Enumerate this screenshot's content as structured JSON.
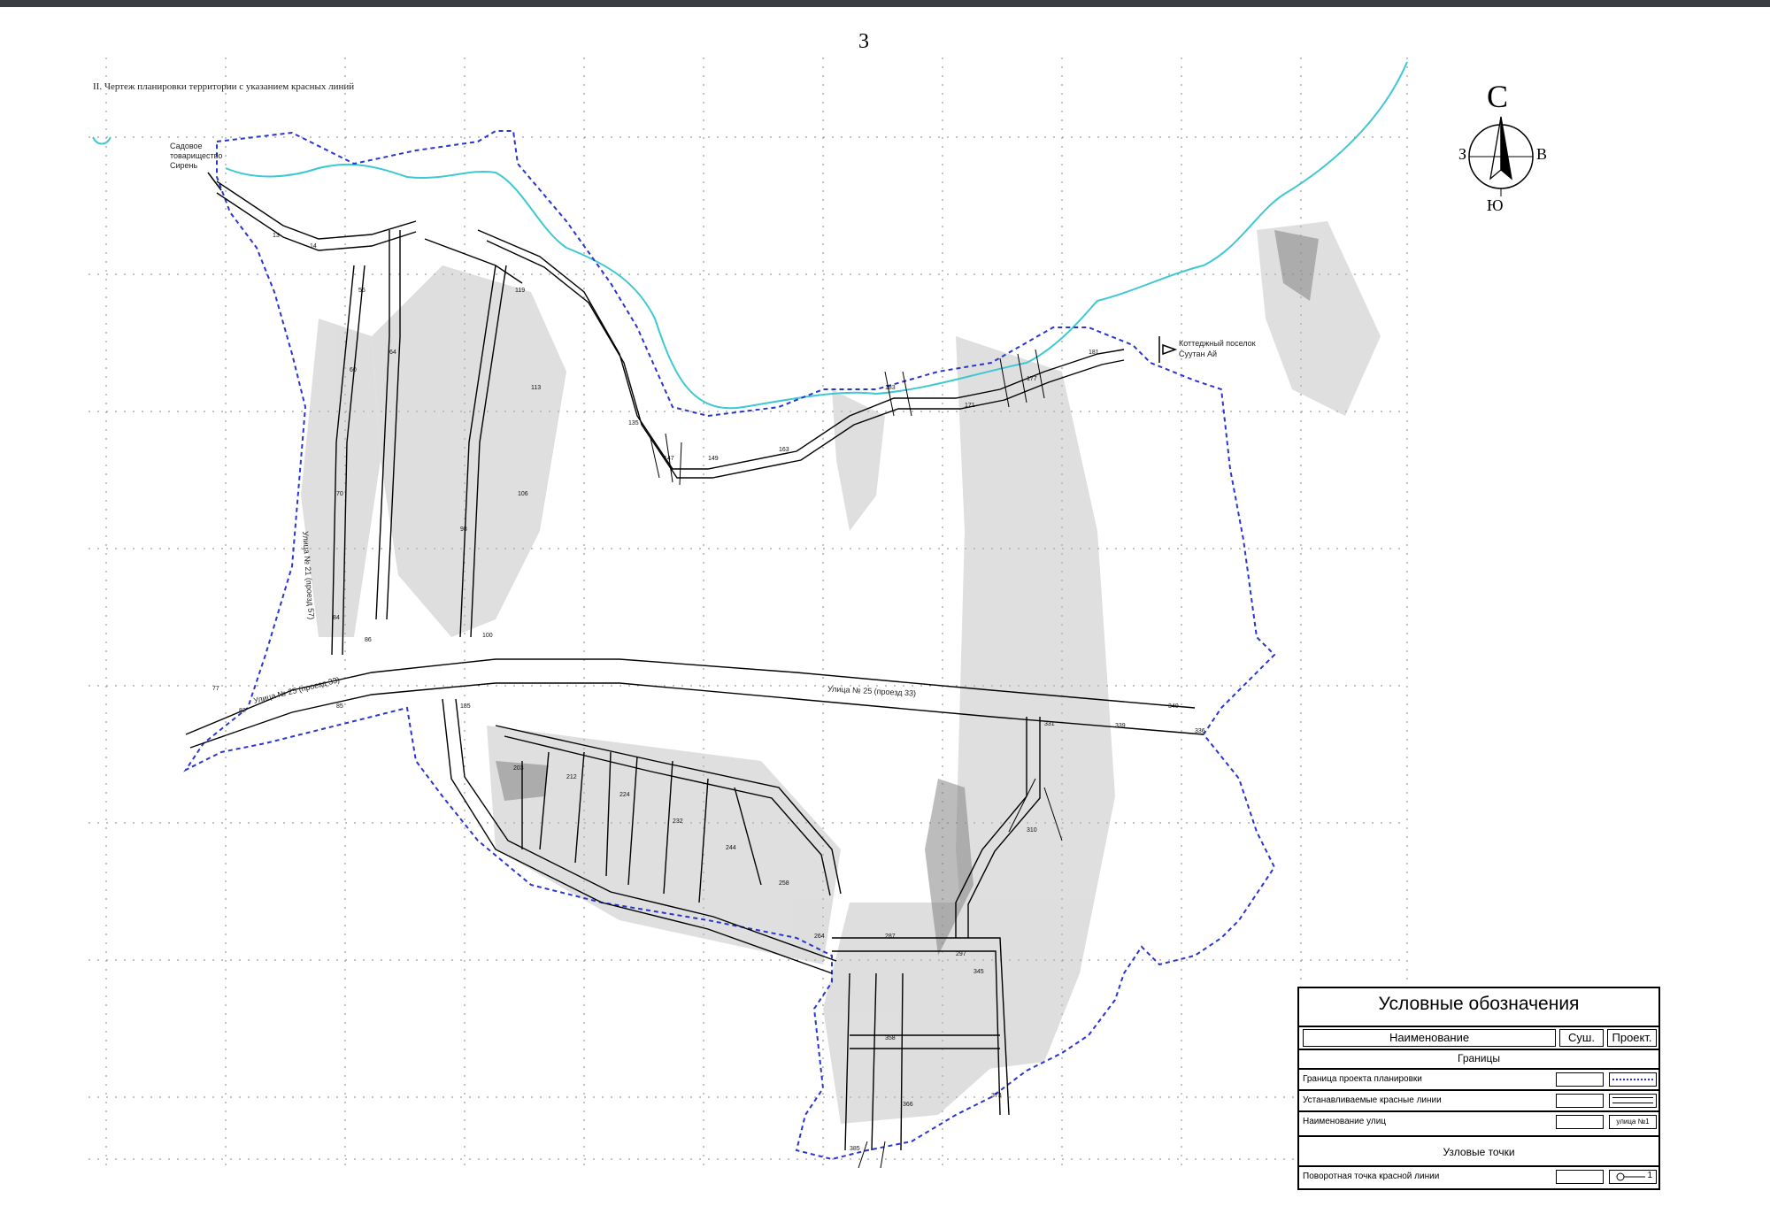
{
  "page": {
    "number": "3",
    "title": "II. Чертеж планировки территории с указанием красных линий"
  },
  "compass": {
    "north": "С",
    "south": "Ю",
    "west": "З",
    "east": "В"
  },
  "annotations": {
    "garden_society": [
      "Садовое",
      "товарищество",
      "Сирень"
    ],
    "cottage": [
      "Коттеджный поселок",
      "Суутан Ай"
    ]
  },
  "streets": [
    "Улица № 25 (проезд 33)",
    "Улица № 25 (проезд 33)",
    "Улица № 21 (проезд 57)"
  ],
  "legend": {
    "title": "Условные обозначения",
    "col_name": "Наименование",
    "col_existing": "Суш.",
    "col_project": "Проект.",
    "section_borders": "Границы",
    "items": [
      "Граница проекта планировки",
      "Устанавливаемые красные линии",
      "Наименование улиц"
    ],
    "street_sample": "улица №1",
    "section_nodes": "Узловые точки",
    "node_item": "Поворотная точка красной линии",
    "node_sample": "1"
  },
  "colors": {
    "boundary": "#2a35d0",
    "river": "#3ec8d2",
    "redline": "#000000",
    "hatch": "#9a9a9a"
  }
}
